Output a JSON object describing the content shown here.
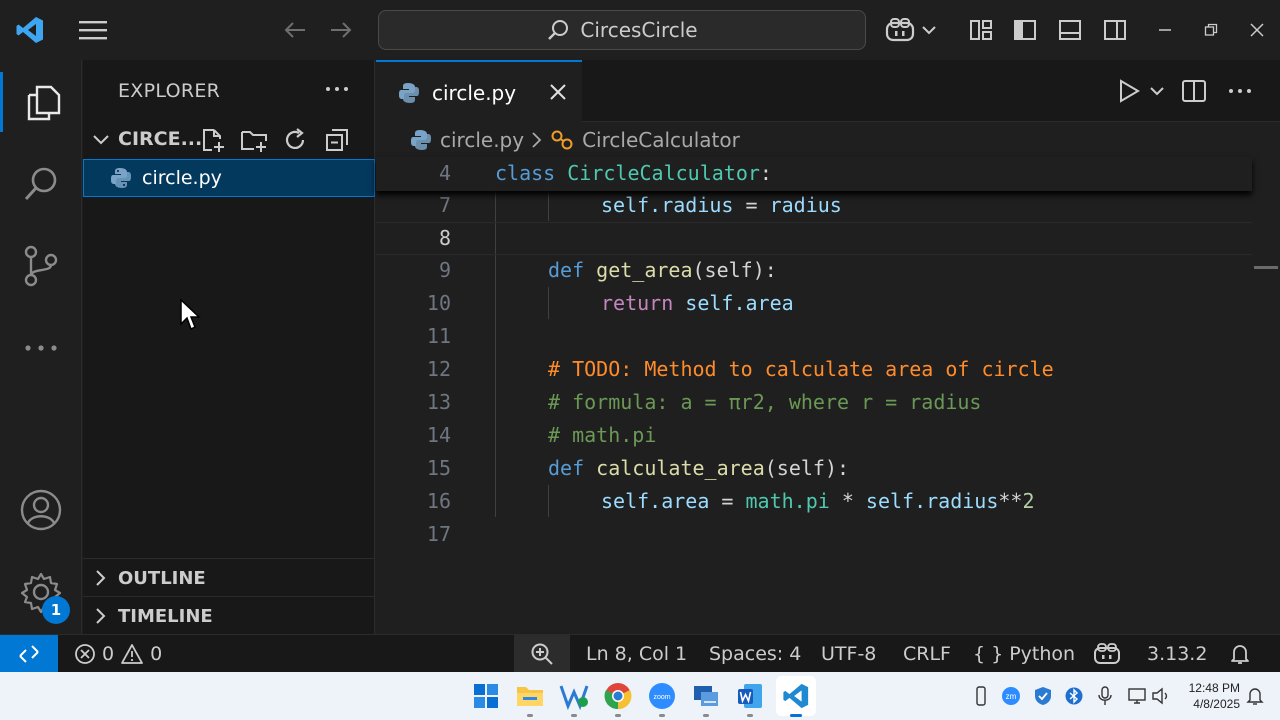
{
  "titlebar": {
    "search_text": "CircesCircle"
  },
  "sidebar": {
    "title": "EXPLORER",
    "folder_name": "CIRCE...",
    "files": [
      {
        "name": "circle.py"
      }
    ],
    "outline_label": "OUTLINE",
    "timeline_label": "TIMELINE"
  },
  "activitybar": {
    "settings_badge": "1"
  },
  "editor": {
    "tab_label": "circle.py",
    "breadcrumb_file": "circle.py",
    "breadcrumb_symbol": "CircleCalculator",
    "lines": [
      {
        "num": "4"
      },
      {
        "num": "7"
      },
      {
        "num": "8"
      },
      {
        "num": "9"
      },
      {
        "num": "10"
      },
      {
        "num": "11"
      },
      {
        "num": "12"
      },
      {
        "num": "13"
      },
      {
        "num": "14"
      },
      {
        "num": "15"
      },
      {
        "num": "16"
      },
      {
        "num": "17"
      }
    ],
    "code": {
      "l4_kw": "class",
      "l4_cls": "CircleCalculator",
      "l4_colon": ":",
      "l7_self": "self",
      "l7_attr": ".radius",
      "l7_eq": " = ",
      "l7_val": "radius",
      "l9_kw": "def",
      "l9_fn": "get_area",
      "l9_args": "(self):",
      "l10_kw": "return",
      "l10_val": "self.area",
      "l12_todo": "# TODO: Method to calculate area of circle",
      "l13_cmt": "# formula: a = πr2, where r = radius",
      "l14_cmt": "# math.pi",
      "l15_kw": "def",
      "l15_fn": "calculate_area",
      "l15_args": "(self):",
      "l16_lhs": "self.area",
      "l16_eq": " = ",
      "l16_math": "math.pi",
      "l16_mul": " * ",
      "l16_rad": "self.radius",
      "l16_pow": "**",
      "l16_num": "2"
    }
  },
  "statusbar": {
    "errors": "0",
    "warnings": "0",
    "position": "Ln 8, Col 1",
    "spaces": "Spaces: 4",
    "encoding": "UTF-8",
    "eol": "CRLF",
    "language": "Python",
    "version": "3.13.2"
  },
  "taskbar": {
    "time": "12:48 PM",
    "date": "4/8/2025",
    "zoom_label": "zoom",
    "zm_label": "zm"
  },
  "colors": {
    "accent": "#0078d4",
    "keyword": "#569cd6",
    "class": "#4ec9b0",
    "function": "#dcdcaa",
    "comment": "#6a9955",
    "todo": "#ff8c2a"
  }
}
